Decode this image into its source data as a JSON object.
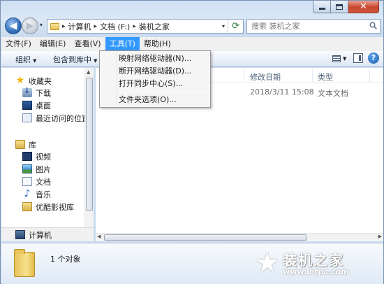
{
  "window": {
    "close_glyph": "✕"
  },
  "nav": {
    "back_arrow": "◀",
    "forward_arrow": "▶",
    "history_caret": "▾"
  },
  "address": {
    "breadcrumbs": [
      "计算机",
      "文档 (F:)",
      "装机之家"
    ],
    "separator": "▸",
    "dropdown_caret": "▾",
    "refresh_glyph": "⟳"
  },
  "search": {
    "placeholder": "搜索 装机之家"
  },
  "menu_bar": {
    "items": [
      "文件(F)",
      "编辑(E)",
      "查看(V)",
      "工具(T)",
      "帮助(H)"
    ],
    "open_item": "工具(T)"
  },
  "command_bar": {
    "organize_label": "组织",
    "include_label": "包含到库中",
    "caret": "▼",
    "help_glyph": "?"
  },
  "nav_pane": {
    "favorites": {
      "label": "收藏夹",
      "items": [
        "下载",
        "桌面",
        "最近访问的位置"
      ]
    },
    "libraries": {
      "label": "库",
      "items": [
        "视频",
        "图片",
        "文档",
        "音乐",
        "优酷影视库"
      ]
    },
    "computer_label": "计算机",
    "scroll_up": "▲",
    "scroll_down": "▼"
  },
  "content": {
    "columns": [
      "修改日期",
      "类型"
    ],
    "files": [
      {
        "modified": "2018/3/11 15:08",
        "type": "文本文档"
      }
    ],
    "scroll_left": "◀",
    "scroll_right": "▶"
  },
  "details": {
    "text": "1 个对象"
  },
  "watermark": {
    "title": "装机之家",
    "url": "www.lotpc.com",
    "star": "★"
  },
  "tools_menu": {
    "items": [
      "映射网络驱动器(N)...",
      "断开网络驱动器(D)...",
      "打开同步中心(S)...",
      "文件夹选项(O)..."
    ]
  },
  "colors": {
    "menu_highlight": "#3399ff",
    "close_button": "#c7452c"
  }
}
